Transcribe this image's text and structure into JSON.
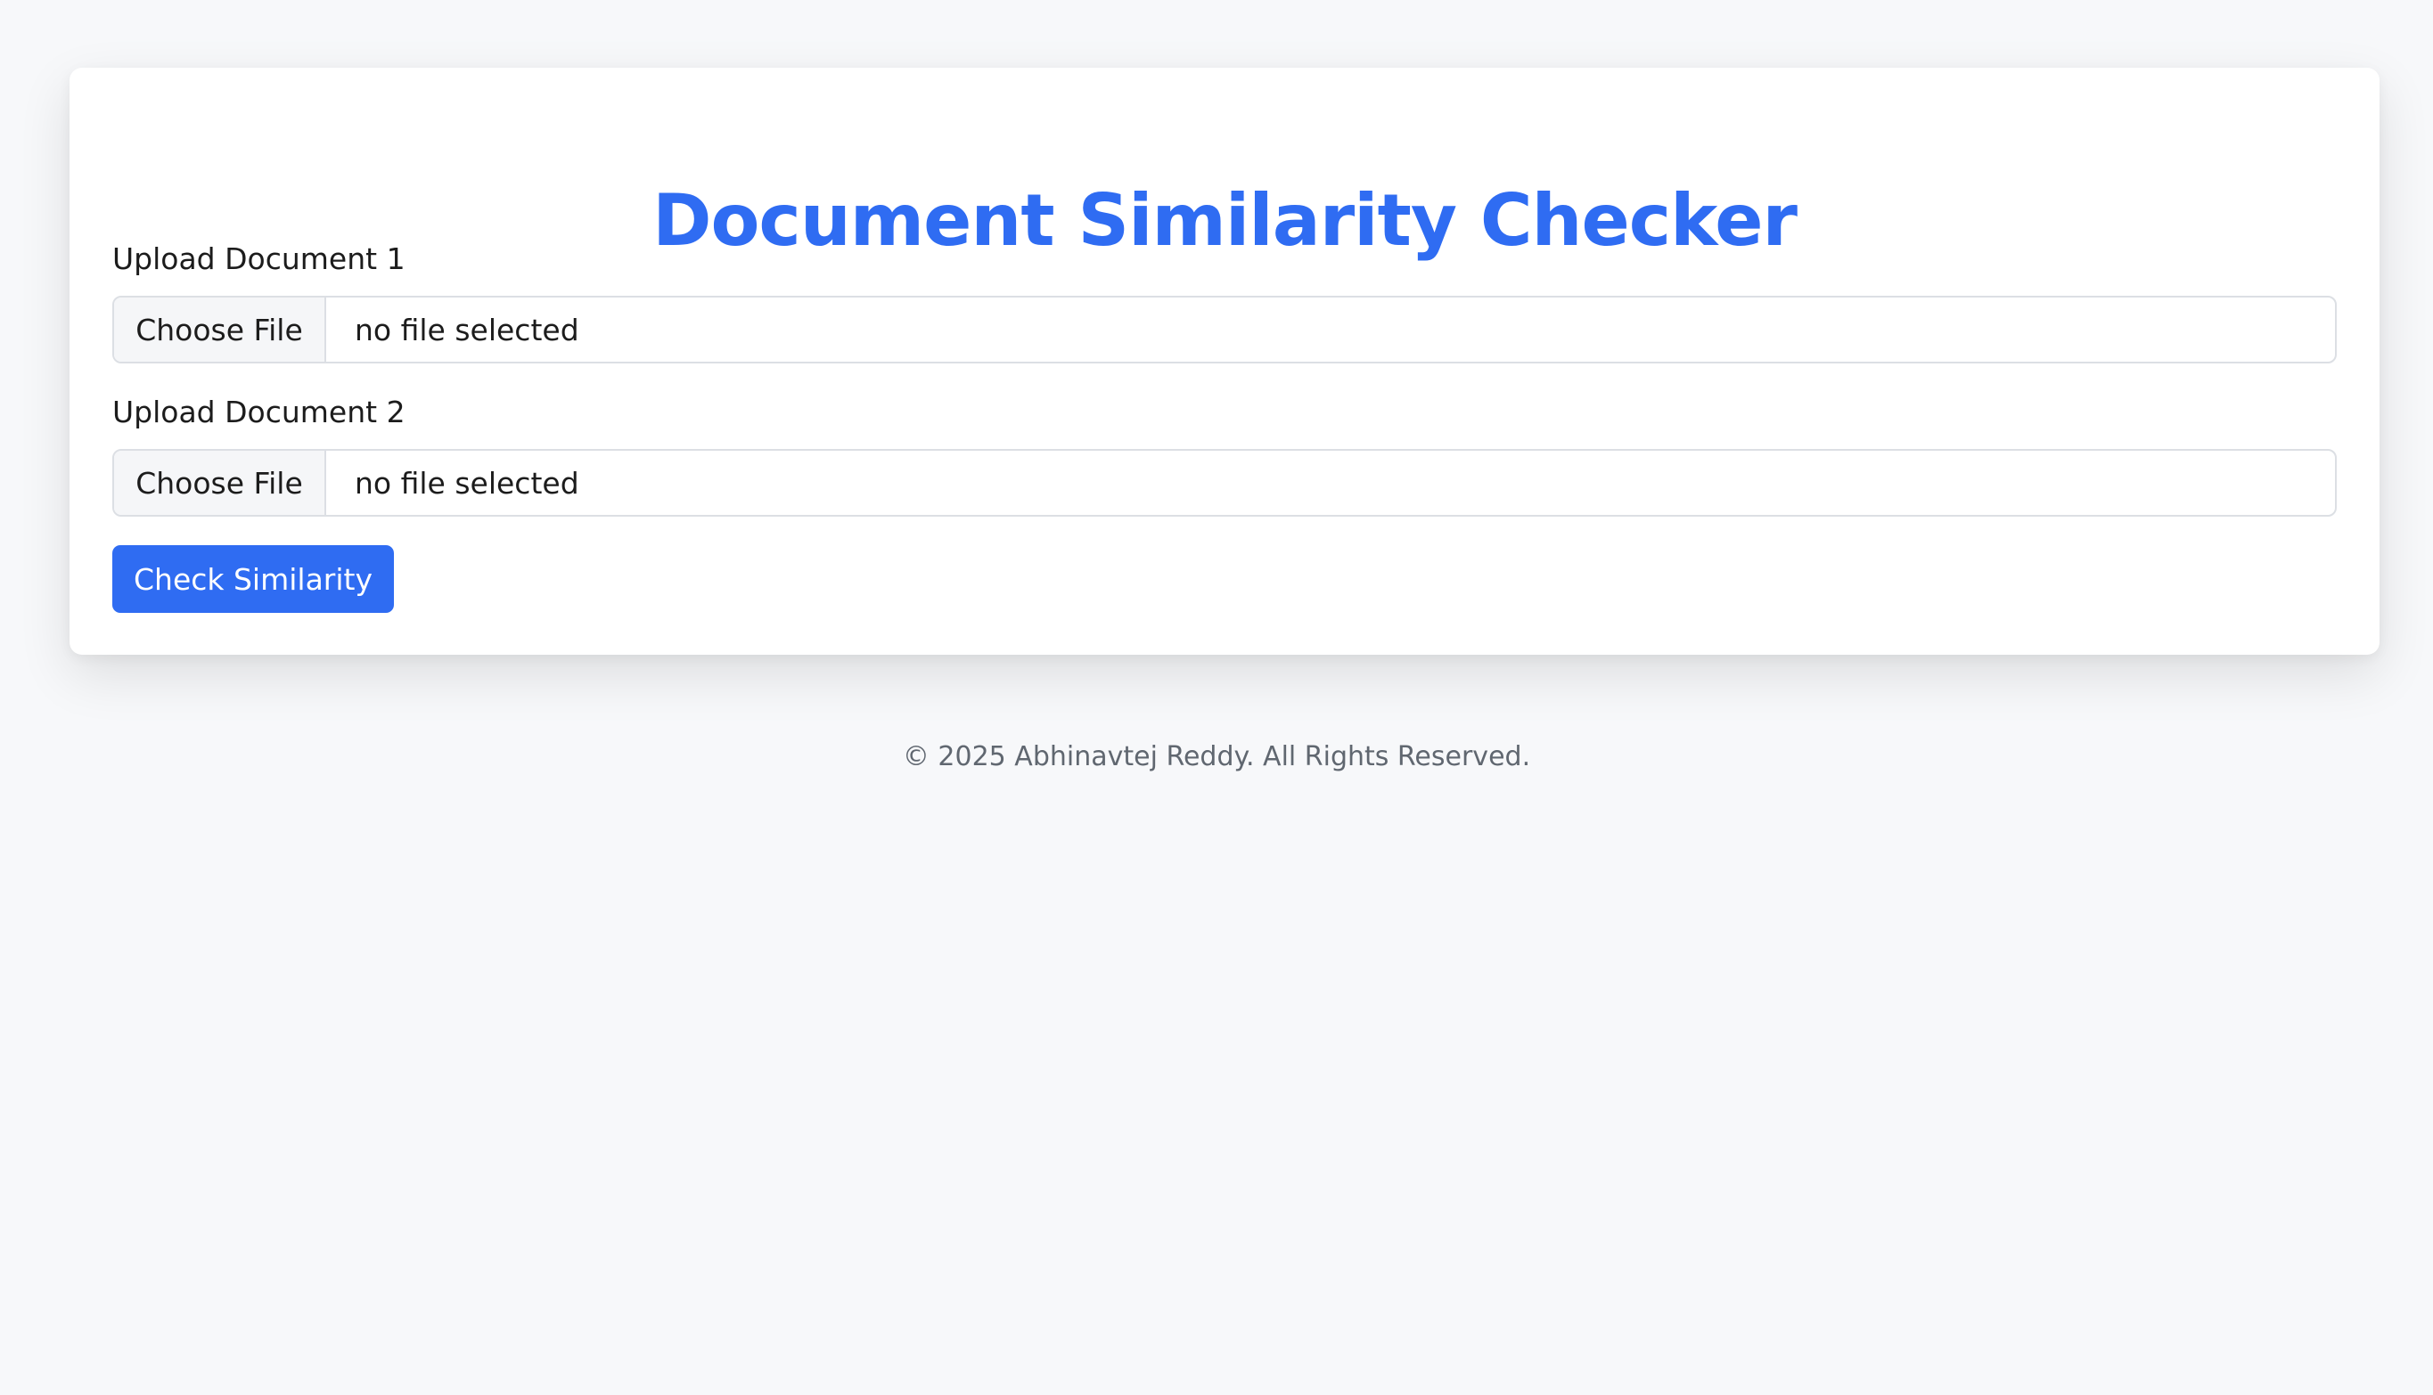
{
  "page": {
    "title": "Document Similarity Checker"
  },
  "form": {
    "doc1_label": "Upload Document 1",
    "doc2_label": "Upload Document 2",
    "choose_file_label": "Choose File",
    "doc1_status": "no file selected",
    "doc2_status": "no file selected",
    "submit_label": "Check Similarity"
  },
  "footer": {
    "text": "© 2025 Abhinavtej Reddy. All Rights Reserved."
  },
  "colors": {
    "accent": "#2f6cf2",
    "background": "#f7f8fa",
    "card": "#ffffff",
    "footer_text": "#606770"
  }
}
